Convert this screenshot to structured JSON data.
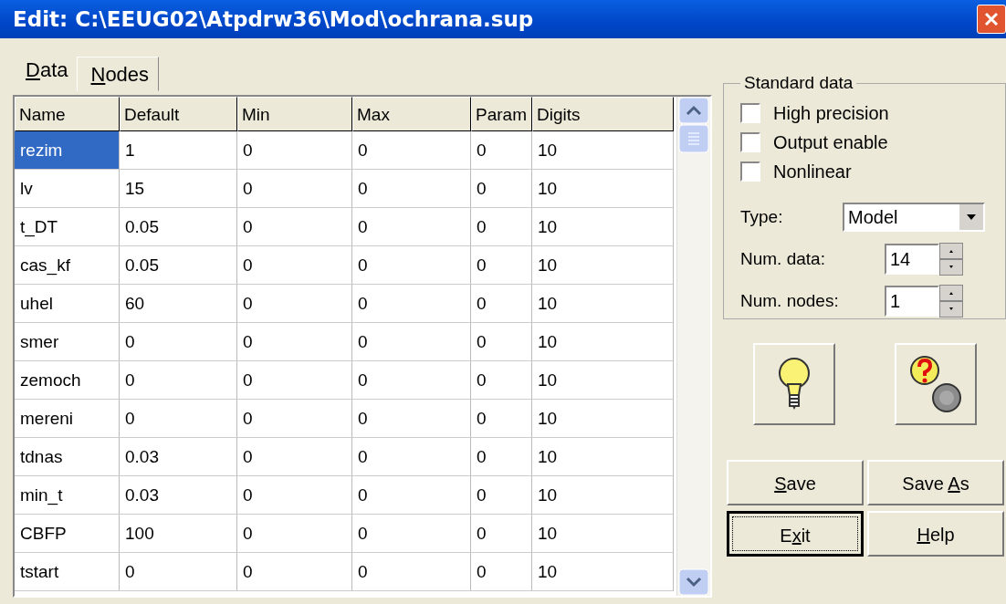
{
  "window": {
    "title": "Edit: C:\\EEUG02\\Atpdrw36\\Mod\\ochrana.sup"
  },
  "tabs": [
    {
      "label": {
        "key": "D",
        "post": "ata"
      },
      "selected": true
    },
    {
      "label": {
        "key": "N",
        "post": "odes"
      },
      "selected": false
    }
  ],
  "table": {
    "columns": [
      "Name",
      "Default",
      "Min",
      "Max",
      "Param",
      "Digits"
    ],
    "rows": [
      {
        "cells": [
          "rezim",
          "1",
          "0",
          "0",
          "0",
          "10"
        ],
        "selected": true
      },
      {
        "cells": [
          "lv",
          "15",
          "0",
          "0",
          "0",
          "10"
        ],
        "selected": false
      },
      {
        "cells": [
          "t_DT",
          "0.05",
          "0",
          "0",
          "0",
          "10"
        ],
        "selected": false
      },
      {
        "cells": [
          "cas_kf",
          "0.05",
          "0",
          "0",
          "0",
          "10"
        ],
        "selected": false
      },
      {
        "cells": [
          "uhel",
          "60",
          "0",
          "0",
          "0",
          "10"
        ],
        "selected": false
      },
      {
        "cells": [
          "smer",
          "0",
          "0",
          "0",
          "0",
          "10"
        ],
        "selected": false
      },
      {
        "cells": [
          "zemoch",
          "0",
          "0",
          "0",
          "0",
          "10"
        ],
        "selected": false
      },
      {
        "cells": [
          "mereni",
          "0",
          "0",
          "0",
          "0",
          "10"
        ],
        "selected": false
      },
      {
        "cells": [
          "tdnas",
          "0.03",
          "0",
          "0",
          "0",
          "10"
        ],
        "selected": false
      },
      {
        "cells": [
          "min_t",
          "0.03",
          "0",
          "0",
          "0",
          "10"
        ],
        "selected": false
      },
      {
        "cells": [
          "CBFP",
          "100",
          "0",
          "0",
          "0",
          "10"
        ],
        "selected": false
      },
      {
        "cells": [
          "tstart",
          "0",
          "0",
          "0",
          "0",
          "10"
        ],
        "selected": false
      }
    ]
  },
  "standard_data": {
    "title": "Standard data",
    "checkboxes": [
      {
        "label": "High precision",
        "checked": false
      },
      {
        "label": "Output enable",
        "checked": false
      },
      {
        "label": "Nonlinear",
        "checked": false
      }
    ],
    "type": {
      "label": "Type:",
      "value": "Model"
    },
    "num_data": {
      "label": "Num. data:",
      "value": "14"
    },
    "num_nodes": {
      "label": "Num. nodes:",
      "value": "1"
    }
  },
  "buttons": [
    {
      "label": {
        "key": "S",
        "post": "ave"
      },
      "focused": false
    },
    {
      "label": {
        "pre": "Save ",
        "key": "A",
        "post": "s"
      },
      "focused": false
    },
    {
      "label": {
        "pre": "E",
        "key": "x",
        "post": "it"
      },
      "focused": true
    },
    {
      "label": {
        "key": "H",
        "post": "elp"
      },
      "focused": false
    }
  ]
}
